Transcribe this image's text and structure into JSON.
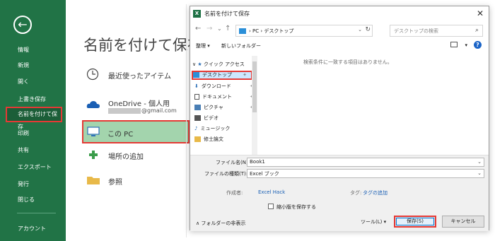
{
  "sidebar": {
    "back_glyph": "←",
    "items": [
      {
        "label": "情報"
      },
      {
        "label": "新規"
      },
      {
        "label": "開く"
      },
      {
        "label": "上書き保存"
      },
      {
        "label": "名前を付けて保存",
        "selected": true
      },
      {
        "label": "印刷"
      },
      {
        "label": "共有"
      },
      {
        "label": "エクスポート"
      },
      {
        "label": "発行"
      },
      {
        "label": "閉じる"
      },
      {
        "label": "アカウント"
      }
    ],
    "accent_color": "#217346"
  },
  "backstage": {
    "title": "名前を付けて保存",
    "locations": [
      {
        "label": "最近使ったアイテム",
        "icon": "clock-icon"
      },
      {
        "label": "OneDrive - 個人用",
        "sub": "@gmail.com",
        "icon": "cloud-icon"
      },
      {
        "label": "この PC",
        "icon": "computer-icon",
        "selected": true
      },
      {
        "label": "場所の追加",
        "icon": "plus-icon"
      },
      {
        "label": "参照",
        "icon": "folder-icon"
      }
    ]
  },
  "dialog": {
    "title": "名前を付けて保存",
    "app_icon_letter": "X",
    "close_glyph": "✕",
    "nav": {
      "back": "←",
      "forward": "→",
      "recent": "⌄",
      "up": "↑"
    },
    "address": {
      "path": "›  PC  ›  デスクトップ",
      "dropdown": "⌄",
      "refresh": "↻"
    },
    "search_placeholder": "デスクトップの検索",
    "toolbar": {
      "organize": "整理 ▾",
      "new_folder": "新しいフォルダー",
      "view_glyph": "▾",
      "help": "?"
    },
    "tree": [
      {
        "label": "クイック アクセス",
        "icon": "star-icon",
        "expander": "∨"
      },
      {
        "label": "デスクトップ",
        "icon": "desktop-icon",
        "pinned": true,
        "selected": true
      },
      {
        "label": "ダウンロード",
        "icon": "download-icon",
        "pinned": true
      },
      {
        "label": "ドキュメント",
        "icon": "document-icon",
        "pinned": true
      },
      {
        "label": "ピクチャ",
        "icon": "picture-icon",
        "pinned": true
      },
      {
        "label": "ビデオ",
        "icon": "video-icon"
      },
      {
        "label": "ミュージック",
        "icon": "music-icon"
      },
      {
        "label": "修士論文",
        "icon": "folder-icon"
      }
    ],
    "empty_message": "検索条件に一致する項目はありません。",
    "filename_label": "ファイル名(N):",
    "filename_value": "Book1",
    "filetype_label": "ファイルの種類(T):",
    "filetype_value": "Excel ブック",
    "author_label": "作成者:",
    "author_value": "Excel Hack",
    "tags_label": "タグ:",
    "tags_value": "タグの追加",
    "thumbnail_label": "縮小版を保存する",
    "hide_folders_label": "∧  フォルダーの非表示",
    "tools_label": "ツール(L)   ▾",
    "save_label": "保存(S)",
    "cancel_label": "キャンセル"
  }
}
